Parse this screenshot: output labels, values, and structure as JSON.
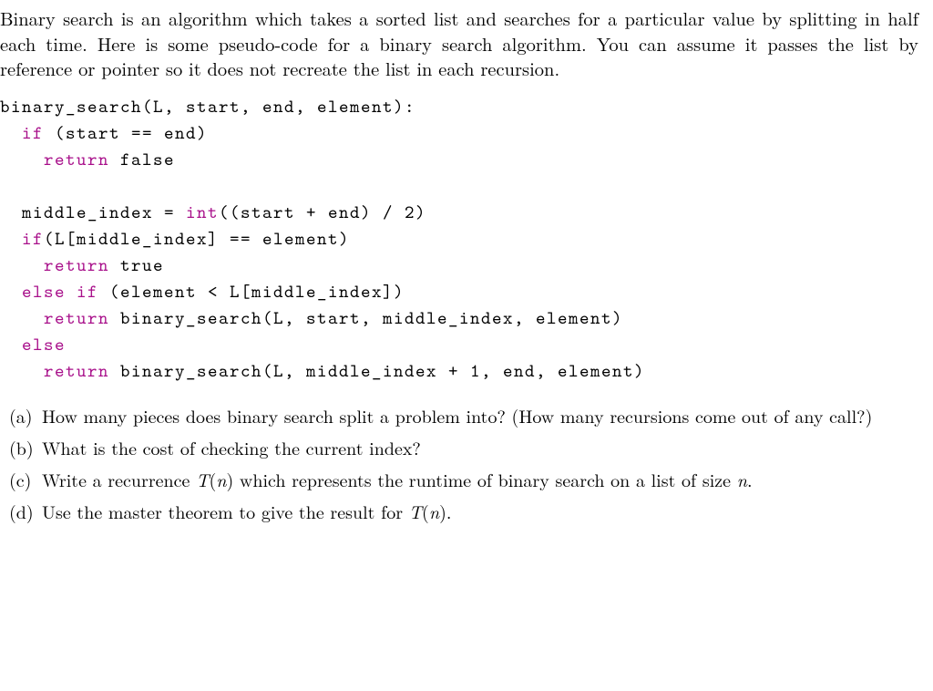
{
  "intro": "Binary search is an algorithm which takes a sorted list and searches for a particular value by splitting in half each time. Here is some pseudo-code for a binary search algorithm. You can assume it passes the list by reference or pointer so it does not recreate the list in each recursion.",
  "code": {
    "l1a": "binary_search(L, start, end, element):",
    "l2a": "  ",
    "l2kw": "if",
    "l2b": " (start == end)",
    "l3a": "    ",
    "l3kw": "return",
    "l3b": " false",
    "blank1": " ",
    "l4a": "  middle_index = ",
    "l4kw": "int",
    "l4b": "((start + end) / 2)",
    "l5a": "  ",
    "l5kw": "if",
    "l5b": "(L[middle_index] == element)",
    "l6a": "    ",
    "l6kw": "return",
    "l6b": " true",
    "l7a": "  ",
    "l7kw1": "else",
    "l7mid": " ",
    "l7kw2": "if",
    "l7b": " (element < L[middle_index])",
    "l8a": "    ",
    "l8kw": "return",
    "l8b": " binary_search(L, start, middle_index, element)",
    "l9a": "  ",
    "l9kw": "else",
    "l10a": "    ",
    "l10kw": "return",
    "l10b": " binary_search(L, middle_index + 1, end, element)"
  },
  "questions": {
    "a": {
      "label": "(a)",
      "text": "How many pieces does binary search split a problem into? (How many recursions come out of any call?)"
    },
    "b": {
      "label": "(b)",
      "text": "What is the cost of checking the current index?"
    },
    "c": {
      "label": "(c)",
      "pre": "Write a recurrence ",
      "math1": "T",
      "math2": "(",
      "math3": "n",
      "math4": ")",
      "mid": " which represents the runtime of binary search on a list of size ",
      "math5": "n",
      "post": "."
    },
    "d": {
      "label": "(d)",
      "pre": "Use the master theorem to give the result for ",
      "math1": "T",
      "math2": "(",
      "math3": "n",
      "math4": ").",
      "post": ""
    }
  }
}
